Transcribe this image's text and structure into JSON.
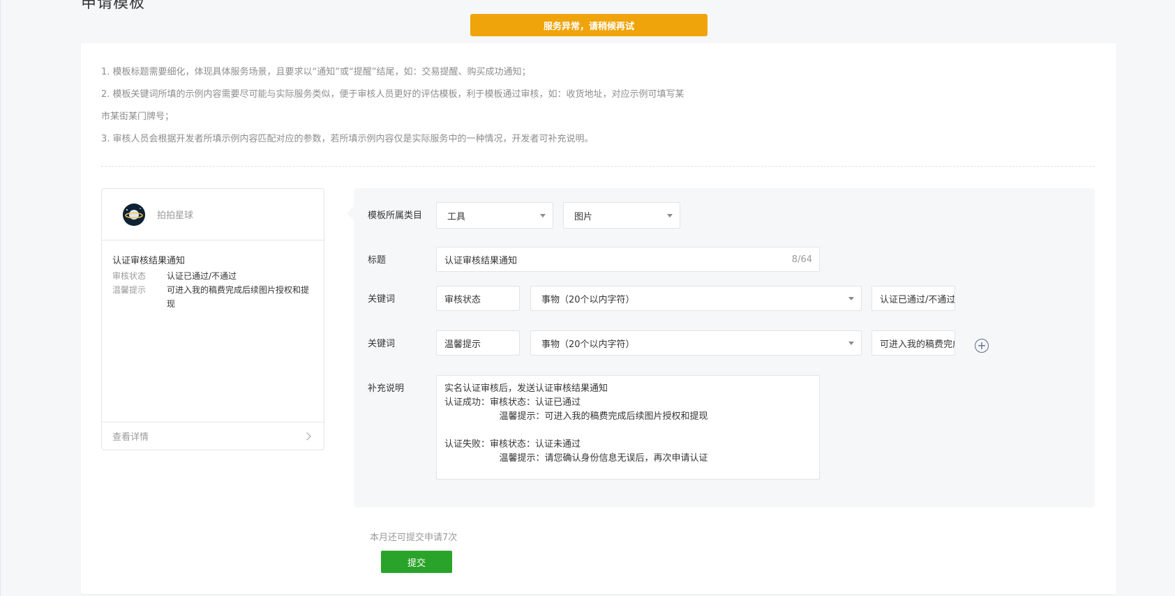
{
  "page": {
    "title": "申请模板"
  },
  "toast": {
    "text": "服务异常，请稍候再试",
    "color": "#efa40c"
  },
  "notes": [
    "1. 模板标题需要细化，体现具体服务场景，且要求以“通知”或“提醒”结尾，如：交易提醒、购买成功通知；",
    "2. 模板关键词所填的示例内容需要尽可能与实际服务类似，便于审核人员更好的评估模板，利于模板通过审核，如：收货地址，对应示例可填写某",
    "市某街某门牌号；",
    "3. 审核人员会根据开发者所填示例内容匹配对应的参数，若所填示例内容仅是实际服务中的一种情况，开发者可补充说明。"
  ],
  "preview": {
    "app_name": "拍拍星球",
    "title": "认证审核结果通知",
    "rows": [
      {
        "key": "审核状态",
        "value": "认证已通过/不通过"
      },
      {
        "key": "温馨提示",
        "value": "可进入我的稿费完成后续图片授权和提现"
      }
    ],
    "footer_link": "查看详情",
    "avatar_icon": "planet-icon"
  },
  "form": {
    "category": {
      "label": "模板所属类目",
      "primary": "工具",
      "secondary": "图片"
    },
    "title": {
      "label": "标题",
      "value": "认证审核结果通知",
      "counter": "8/64"
    },
    "keywords": [
      {
        "label": "关键词",
        "name": "审核状态",
        "type": "事物（20个以内字符）",
        "example": "认证已通过/不通过"
      },
      {
        "label": "关键词",
        "name": "温馨提示",
        "type": "事物（20个以内字符）",
        "example": "可进入我的稿费完成后续图片授权和提现"
      }
    ],
    "supplement": {
      "label": "补充说明",
      "value": "实名认证审核后，发送认证审核结果通知\n认证成功：审核状态：认证已通过\n                   温馨提示：可进入我的稿费完成后续图片授权和提现\n\n认证失败：审核状态：认证未通过\n                   温馨提示：请您确认身份信息无误后，再次申请认证"
    }
  },
  "quota_text": "本月还可提交申请7次",
  "submit_label": "提交",
  "colors": {
    "primary_button": "#2aa32a",
    "toast": "#efa40c",
    "add_icon": "#5a6b8c"
  }
}
